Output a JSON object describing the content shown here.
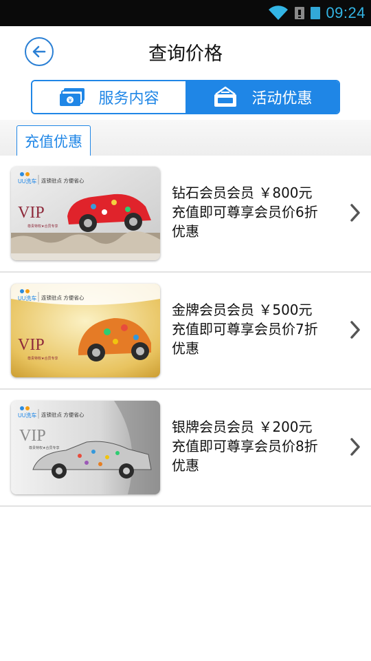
{
  "status_bar": {
    "time": "09:24",
    "icons": [
      "wifi-icon",
      "sim-signal-icon",
      "battery-icon"
    ]
  },
  "header": {
    "title": "查询价格",
    "back_icon": "back-arrow-icon"
  },
  "tabs": [
    {
      "label": "服务内容",
      "icon": "money-icon",
      "active": false
    },
    {
      "label": "活动优惠",
      "icon": "gift-card-icon",
      "active": true
    }
  ],
  "subtab": {
    "label": "充值优惠"
  },
  "memberships": [
    {
      "line1": "钻石会员会员 ￥800元",
      "line2": "充值即可尊享会员价6折",
      "line3": "优惠",
      "card": {
        "brand": "UU洗车",
        "slogan": "连锁驻点 方便省心",
        "vip": "VIP",
        "tagline": "尊贵特权★合员专享"
      }
    },
    {
      "line1": "金牌会员会员 ￥500元",
      "line2": "充值即可尊享会员价7折",
      "line3": "优惠",
      "card": {
        "brand": "UU洗车",
        "slogan": "连锁驻点 方便省心",
        "vip": "VIP",
        "tagline": "尊贵特权★合员专享"
      }
    },
    {
      "line1": "银牌会员会员 ￥200元",
      "line2": "充值即可尊享会员价8折",
      "line3": "优惠",
      "card": {
        "brand": "UU洗车",
        "slogan": "连锁驻点 方便省心",
        "vip": "VIP",
        "tagline": "尊贵特权★合员专享"
      }
    }
  ],
  "colors": {
    "accent": "#1f86e6",
    "status_time": "#33b5e5",
    "divider": "#e2e2e2"
  }
}
